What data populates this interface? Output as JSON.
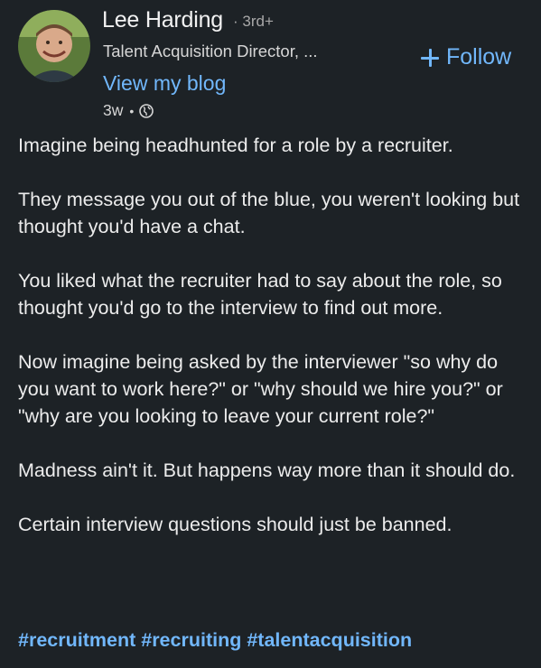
{
  "author": {
    "name": "Lee Harding",
    "degree": "3rd+",
    "headline": "Talent Acquisition Director, ...",
    "blog_link": "View my blog",
    "time_ago": "3w",
    "visibility_icon": "globe-icon"
  },
  "actions": {
    "follow_label": "Follow",
    "follow_icon": "plus-icon"
  },
  "post": {
    "paragraphs": [
      "Imagine being headhunted for a role by a recruiter.",
      "They message you out of the blue, you weren't looking but thought you'd have a chat.",
      "You liked what the recruiter had to say about the role, so thought you'd go to the interview to find out more.",
      "Now imagine being asked by the interviewer \"so why do you want to work here?\" or \"why should we hire you?\" or \"why are you looking to leave your current role?\"",
      "Madness ain't it. But happens way more than it should do.",
      "Certain interview questions should just be banned."
    ],
    "hashtags": [
      "#recruitment",
      "#recruiting",
      "#talentacquisition"
    ]
  },
  "colors": {
    "background": "#1d2226",
    "link": "#71b7fb",
    "text": "#ececec",
    "muted": "#a8a8a8"
  }
}
